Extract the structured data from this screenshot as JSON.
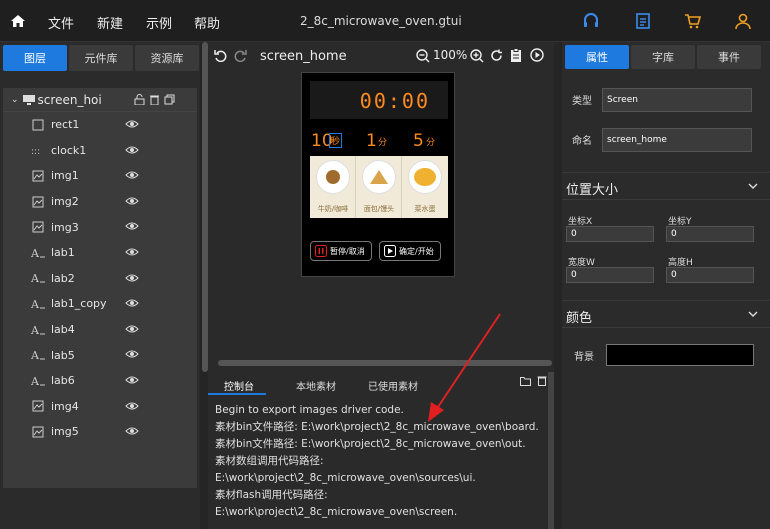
{
  "menu": {
    "file": "文件",
    "new": "新建",
    "example": "示例",
    "help": "帮助"
  },
  "window_title": "2_8c_microwave_oven.gtui",
  "left_tabs": [
    "图层",
    "元件库",
    "资源库"
  ],
  "tree_root": "screen_hoi",
  "tree_items": [
    "rect1",
    "clock1",
    "img1",
    "img2",
    "img3",
    "lab1",
    "lab2",
    "lab1_copy",
    "lab4",
    "lab5",
    "lab6",
    "img4",
    "img5"
  ],
  "center": {
    "screen_name": "screen_home",
    "zoom": "100%"
  },
  "device": {
    "clock": "00:00",
    "n1": "10",
    "u1": "秒",
    "n2": "1",
    "u2": "分",
    "n3": "5",
    "u3": "分",
    "foods": [
      "牛奶/咖啡",
      "面包/馒头",
      "菜水蛋"
    ],
    "btn1": "暂停/取消",
    "btn2": "确定/开始"
  },
  "bottom_tabs": [
    "控制台",
    "本地素材",
    "已使用素材"
  ],
  "log": [
    "Begin to export images driver code.",
    "素材bin文件路径: E:\\work\\project\\2_8c_microwave_oven\\board.",
    "素材bin文件路径: E:\\work\\project\\2_8c_microwave_oven\\out.",
    "素材数组调用代码路径:",
    "E:\\work\\project\\2_8c_microwave_oven\\sources\\ui.",
    "素材flash调用代码路径:",
    "E:\\work\\project\\2_8c_microwave_oven\\screen."
  ],
  "right_tabs": [
    "属性",
    "字库",
    "事件"
  ],
  "props": {
    "type_label": "类型",
    "type_value": "Screen",
    "name_label": "命名",
    "name_value": "screen_home",
    "section_pos": "位置大小",
    "x_label": "坐标X",
    "x_value": "0",
    "y_label": "坐标Y",
    "y_value": "0",
    "w_label": "宽度W",
    "w_value": "0",
    "h_label": "高度H",
    "h_value": "0",
    "section_color": "颜色",
    "bg_label": "背景"
  },
  "colors": {
    "accent": "#1f7ae0",
    "digits": "#ff8a1e",
    "arrow": "#e02020"
  }
}
